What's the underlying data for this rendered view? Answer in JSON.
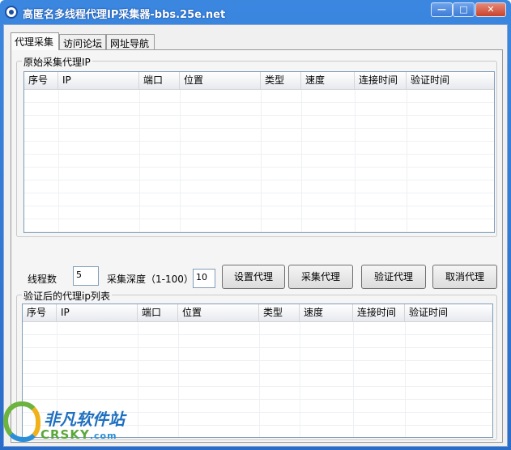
{
  "window": {
    "title": "高匿名多线程代理IP采集器-bbs.25e.net",
    "minimize_glyph": "—",
    "maximize_glyph": "□",
    "close_glyph": "✕"
  },
  "tabs": [
    "代理采集",
    "访问论坛",
    "网址导航"
  ],
  "raw_proxy_group": {
    "label": "原始采集代理IP",
    "columns": [
      "序号",
      "IP",
      "端口",
      "位置",
      "类型",
      "速度",
      "连接时间",
      "验证时间"
    ]
  },
  "controls": {
    "threads_label": "线程数",
    "threads_value": "5",
    "depth_label": "采集深度（1-100）",
    "depth_value": "10",
    "set_proxy_button": "设置代理",
    "collect_proxy_button": "采集代理",
    "verify_proxy_button": "验证代理",
    "cancel_proxy_button": "取消代理"
  },
  "verified_group": {
    "label": "验证后的代理ip列表",
    "columns": [
      "序号",
      "IP",
      "端口",
      "位置",
      "类型",
      "速度",
      "连接时间",
      "验证时间"
    ]
  },
  "watermark": {
    "name": "非凡软件站",
    "domain": "CRSKY",
    "tld": ".com"
  }
}
